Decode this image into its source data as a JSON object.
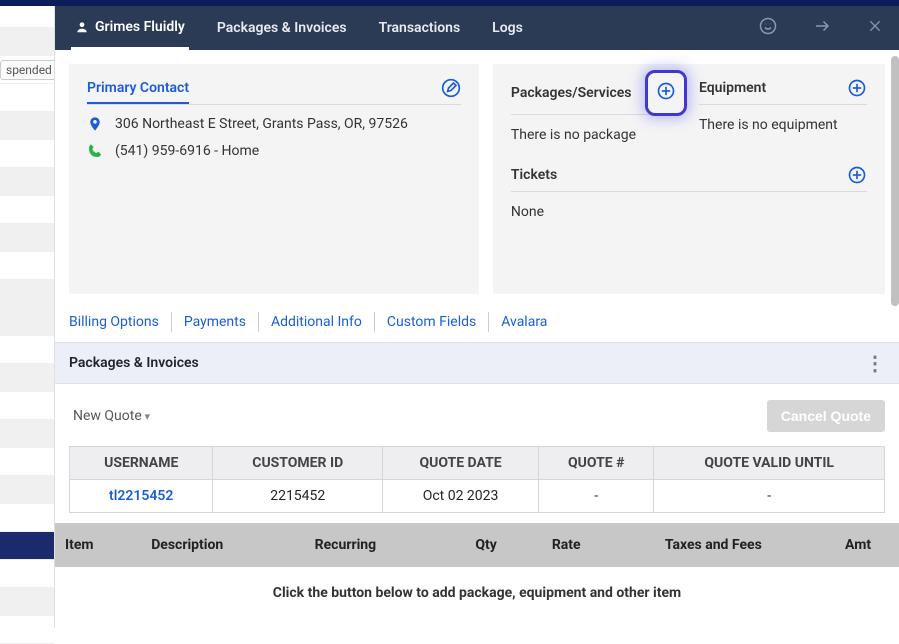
{
  "bg_badge": "spended",
  "header": {
    "tabs": [
      {
        "label": "Grimes Fluidly",
        "active": true,
        "has_icon": true
      },
      {
        "label": "Packages & Invoices",
        "active": false
      },
      {
        "label": "Transactions",
        "active": false
      },
      {
        "label": "Logs",
        "active": false
      }
    ]
  },
  "contact_card": {
    "title": "Primary Contact",
    "address": "306 Northeast E Street, Grants Pass, OR, 97526",
    "phone": "(541) 959-6916 - Home"
  },
  "right_card": {
    "packages": {
      "title": "Packages/Services",
      "empty_text": "There is no package"
    },
    "equipment": {
      "title": "Equipment",
      "empty_text": "There is no equipment"
    },
    "tickets": {
      "title": "Tickets",
      "empty_text": "None"
    }
  },
  "linkbar": [
    "Billing Options",
    "Payments",
    "Additional Info",
    "Custom Fields",
    "Avalara"
  ],
  "section": {
    "title": "Packages & Invoices"
  },
  "quote_bar": {
    "new_label": "New Quote",
    "cancel_label": "Cancel Quote"
  },
  "quote_table": {
    "headers": [
      "USERNAME",
      "CUSTOMER ID",
      "QUOTE DATE",
      "QUOTE #",
      "QUOTE VALID UNTIL"
    ],
    "row": {
      "username": "tl2215452",
      "customer_id": "2215452",
      "quote_date": "Oct 02 2023",
      "quote_num": "-",
      "valid_until": "-"
    }
  },
  "cols_table": {
    "headers": [
      "Item",
      "Description",
      "Recurring",
      "Qty",
      "Rate",
      "Taxes and Fees",
      "Amt"
    ],
    "empty_text": "Click the button below to add package, equipment and other item"
  }
}
